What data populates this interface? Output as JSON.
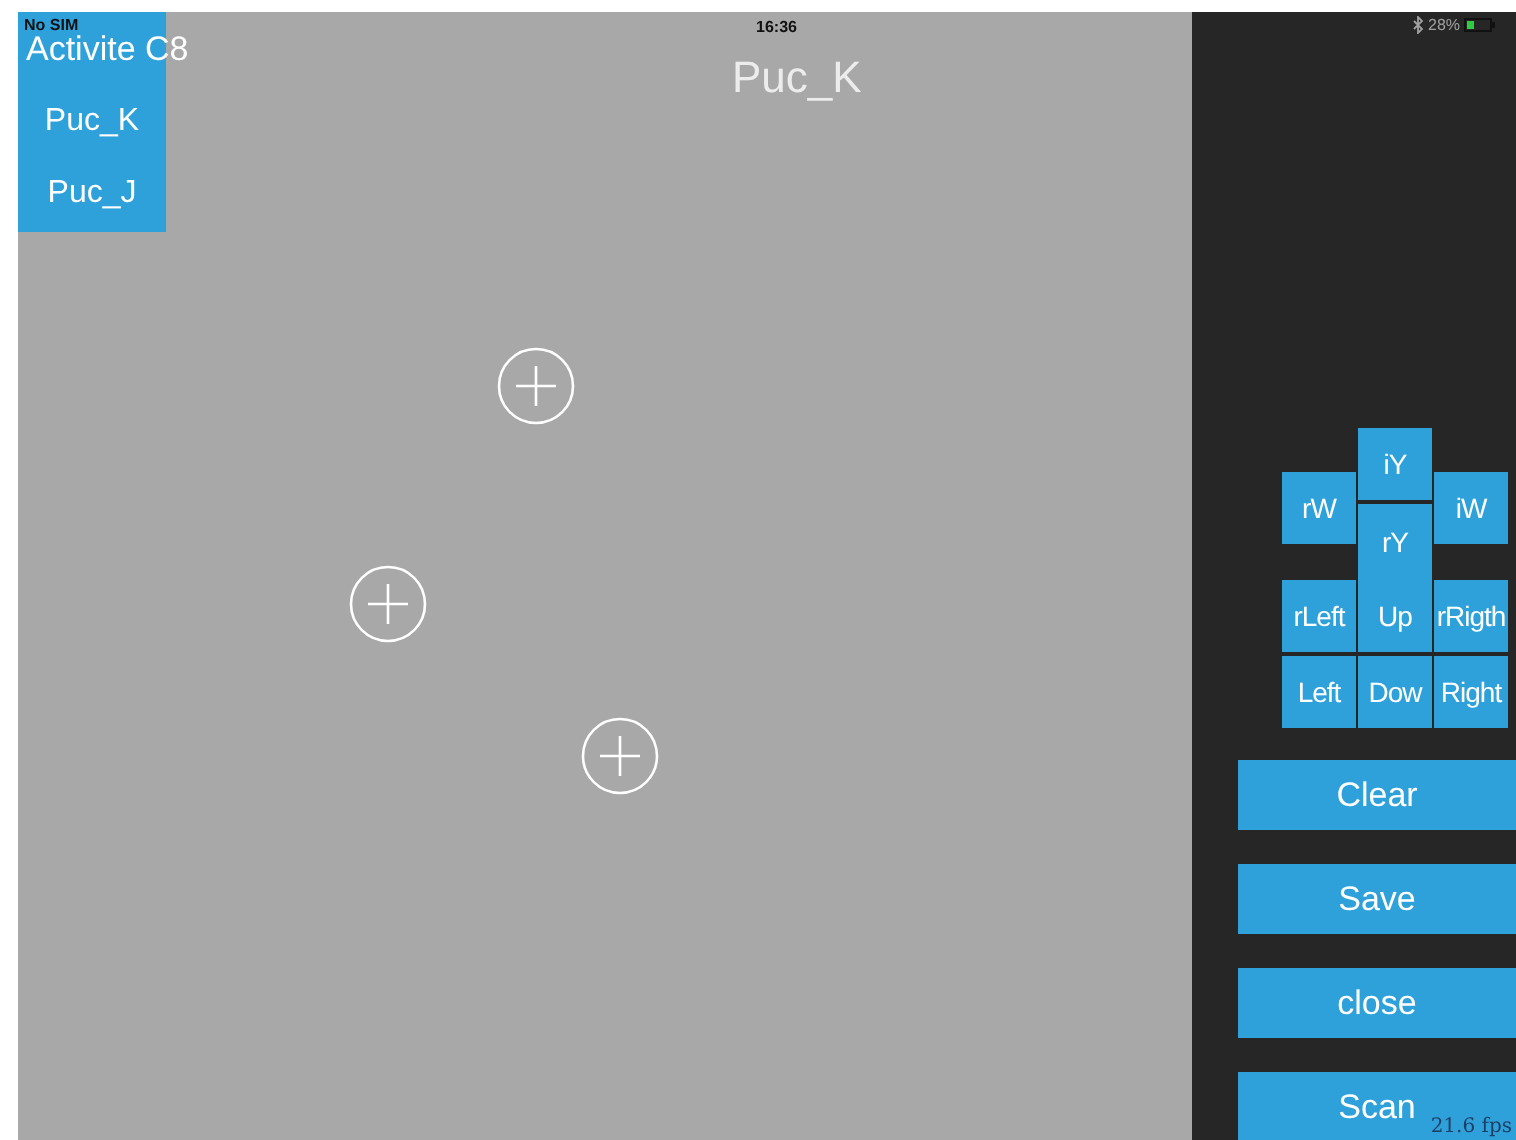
{
  "status_bar": {
    "carrier": "No SIM",
    "time": "16:36",
    "battery": "28%"
  },
  "menu": {
    "title": "Activite C8",
    "items": [
      "Puc_K",
      "Puc_J"
    ]
  },
  "screen_title": "Puc_K",
  "pad": {
    "top": [
      {
        "label": "rW"
      },
      {
        "label": "iY"
      },
      {
        "label": "rY"
      },
      {
        "label": "iW"
      }
    ],
    "rows": [
      [
        "rLeft",
        "Up",
        "rRigth"
      ],
      [
        "Left",
        "Dow",
        "Right"
      ]
    ]
  },
  "actions": [
    "Clear",
    "Save",
    "close",
    "Scan"
  ],
  "fps": "21.6 fps"
}
